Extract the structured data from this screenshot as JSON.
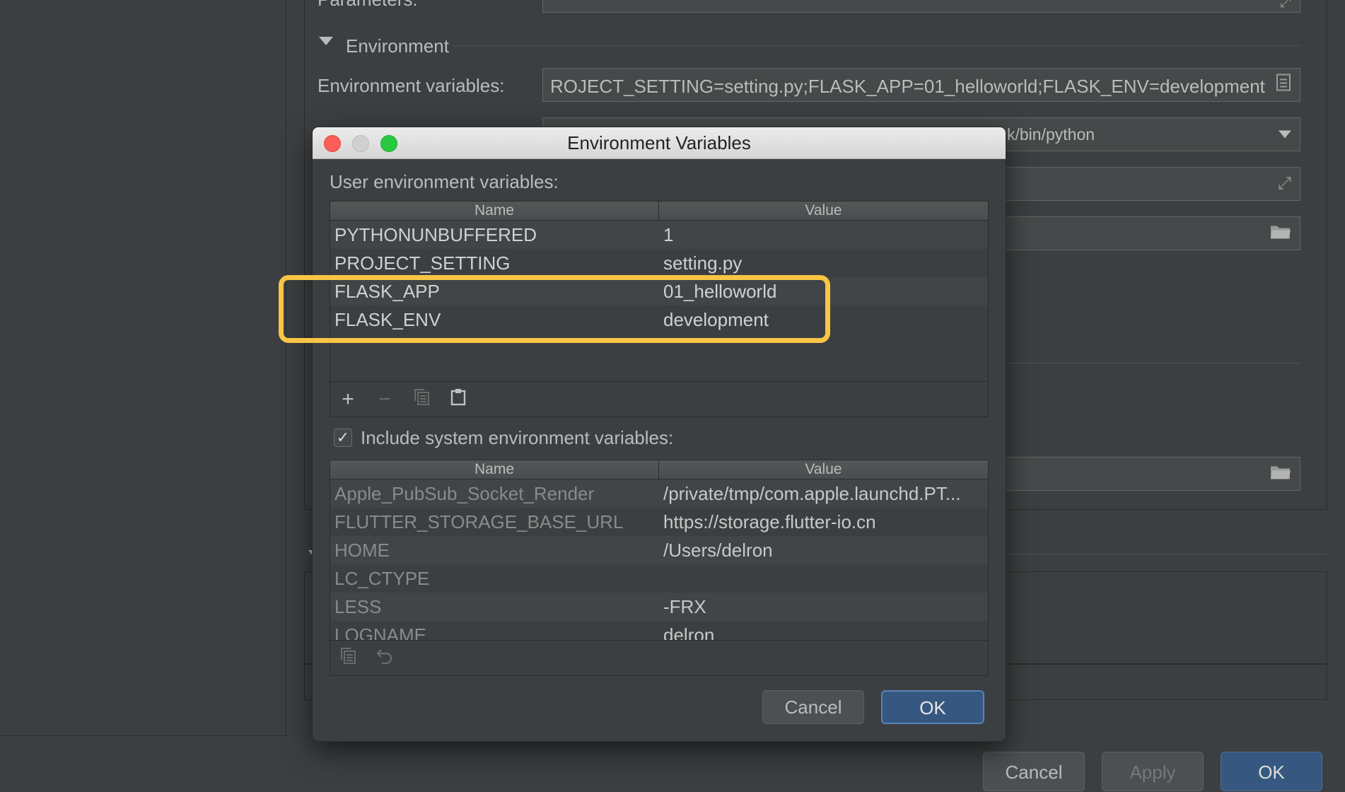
{
  "background": {
    "parameters_label": "Parameters:",
    "environment_section": "Environment",
    "env_vars_label": "Environment variables:",
    "env_vars_value": "ROJECT_SETTING=setting.py;FLASK_APP=01_helloworld;FLASK_ENV=development",
    "interpreter_value": "k/bin/python",
    "buttons": {
      "cancel": "Cancel",
      "apply": "Apply",
      "ok": "OK"
    }
  },
  "dialog": {
    "title": "Environment Variables",
    "user_section_label": "User environment variables:",
    "columns": {
      "name": "Name",
      "value": "Value"
    },
    "user_vars": [
      {
        "name": "PYTHONUNBUFFERED",
        "value": "1"
      },
      {
        "name": "PROJECT_SETTING",
        "value": "setting.py"
      },
      {
        "name": "FLASK_APP",
        "value": "01_helloworld"
      },
      {
        "name": "FLASK_ENV",
        "value": "development"
      }
    ],
    "include_system_label": "Include system environment variables:",
    "include_system_checked": true,
    "system_vars": [
      {
        "name": "Apple_PubSub_Socket_Render",
        "value": "/private/tmp/com.apple.launchd.PT..."
      },
      {
        "name": "FLUTTER_STORAGE_BASE_URL",
        "value": "https://storage.flutter-io.cn"
      },
      {
        "name": "HOME",
        "value": "/Users/delron"
      },
      {
        "name": "LC_CTYPE",
        "value": ""
      },
      {
        "name": "LESS",
        "value": "-FRX"
      },
      {
        "name": "LOGNAME",
        "value": "delron"
      }
    ],
    "buttons": {
      "cancel": "Cancel",
      "ok": "OK"
    }
  },
  "icons": {
    "add": "plus-icon",
    "remove": "minus-icon",
    "copy": "copy-icon",
    "paste": "paste-icon",
    "undo": "undo-icon",
    "folder": "folder-icon",
    "expand": "expand-icon",
    "dropdown": "chevron-down-icon"
  },
  "colors": {
    "background": "#3c3f41",
    "highlight": "#f8c544",
    "primary_button": "#365880"
  }
}
